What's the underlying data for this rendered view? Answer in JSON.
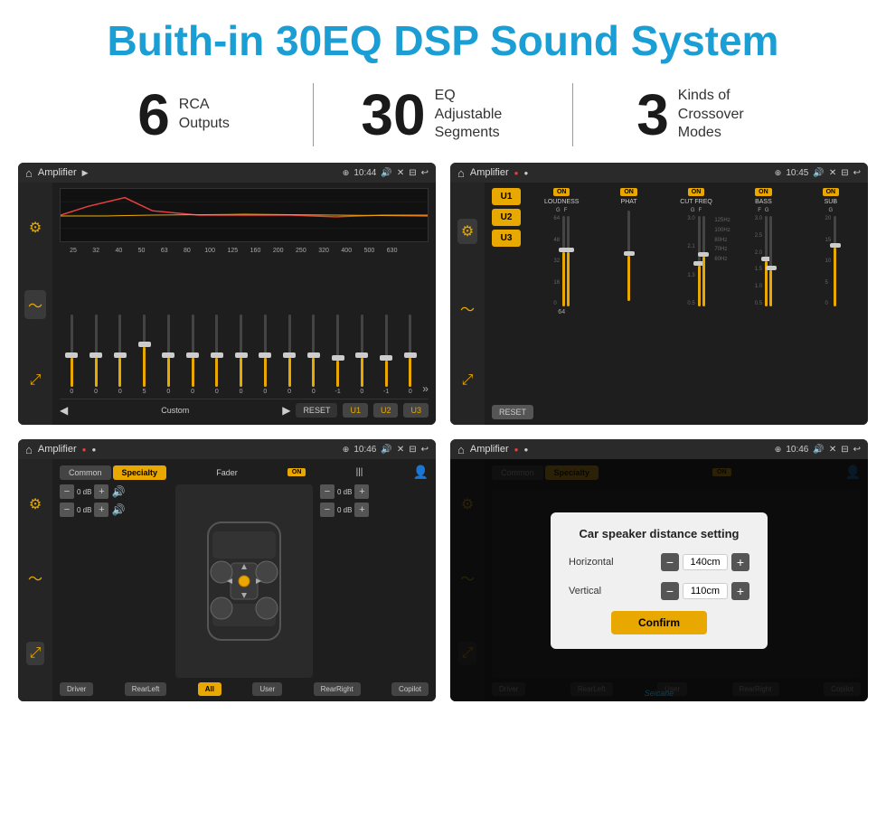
{
  "header": {
    "title": "Buith-in 30EQ DSP Sound System"
  },
  "stats": [
    {
      "number": "6",
      "text": "RCA\nOutputs"
    },
    {
      "number": "30",
      "text": "EQ Adjustable\nSegments"
    },
    {
      "number": "3",
      "text": "Kinds of\nCrossover Modes"
    }
  ],
  "screen1": {
    "title": "Amplifier",
    "time": "10:44",
    "frequencies": [
      "25",
      "32",
      "40",
      "50",
      "63",
      "80",
      "100",
      "125",
      "160",
      "200",
      "250",
      "320",
      "400",
      "500",
      "630"
    ],
    "values": [
      "0",
      "0",
      "0",
      "5",
      "0",
      "0",
      "0",
      "0",
      "0",
      "0",
      "0",
      "-1",
      "0",
      "-1"
    ],
    "presets": [
      "Custom",
      "RESET",
      "U1",
      "U2",
      "U3"
    ]
  },
  "screen2": {
    "title": "Amplifier",
    "time": "10:45",
    "units": [
      "U1",
      "U2",
      "U3"
    ],
    "channels": [
      {
        "on": true,
        "name": "LOUDNESS",
        "labels": [
          "G",
          "F"
        ]
      },
      {
        "on": true,
        "name": "PHAT",
        "labels": [
          "",
          ""
        ]
      },
      {
        "on": true,
        "name": "CUT FREQ",
        "labels": [
          "G",
          "F"
        ]
      },
      {
        "on": true,
        "name": "BASS",
        "labels": [
          "F",
          "G"
        ]
      },
      {
        "on": true,
        "name": "SUB",
        "labels": [
          "G",
          ""
        ]
      }
    ],
    "reset": "RESET"
  },
  "screen3": {
    "title": "Amplifier",
    "time": "10:46",
    "tabs": [
      "Common",
      "Specialty"
    ],
    "fader": "Fader",
    "on": "ON",
    "zones": [
      "Driver",
      "RearLeft",
      "All",
      "User",
      "RearRight",
      "Copilot"
    ],
    "dbValues": [
      "0 dB",
      "0 dB",
      "0 dB",
      "0 dB"
    ]
  },
  "screen4": {
    "title": "Amplifier",
    "time": "10:46",
    "tabs": [
      "Common",
      "Specialty"
    ],
    "on": "ON",
    "dialog": {
      "title": "Car speaker distance setting",
      "horizontal_label": "Horizontal",
      "horizontal_value": "140cm",
      "vertical_label": "Vertical",
      "vertical_value": "110cm",
      "confirm_label": "Confirm"
    },
    "zones": [
      "Driver",
      "RearLeft",
      "User",
      "RearRight",
      "Copilot"
    ],
    "dbValues": [
      "0 dB",
      "0 dB"
    ]
  },
  "watermark": "Seicane"
}
